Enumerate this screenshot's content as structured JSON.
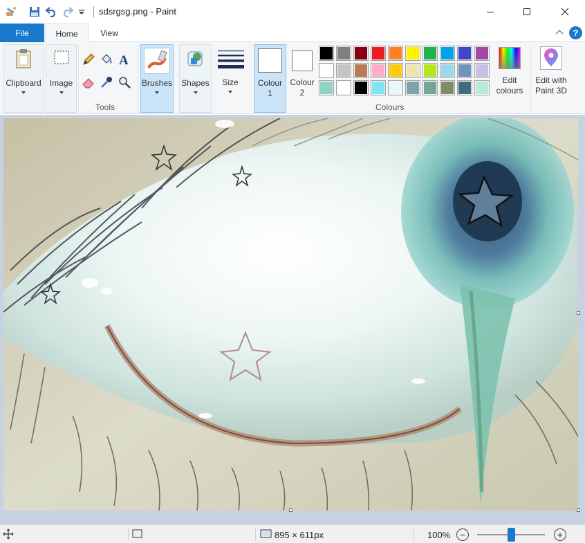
{
  "window": {
    "title": "sdsrgsg.png - Paint",
    "minimize_icon": "minimize-icon",
    "maximize_icon": "maximize-icon",
    "close_icon": "close-icon"
  },
  "quick_access": {
    "app_icon": "paint-app-icon",
    "save_icon": "save-icon",
    "undo_icon": "undo-icon",
    "redo_icon": "redo-icon",
    "customize_icon": "dropdown-arrow-icon"
  },
  "tabs": {
    "file": "File",
    "home": "Home",
    "view": "View",
    "help": "?"
  },
  "ribbon": {
    "clipboard": "Clipboard",
    "image": "Image",
    "tools_label": "Tools",
    "brushes": "Brushes",
    "shapes": "Shapes",
    "size": "Size",
    "colour1_line1": "Colour",
    "colour1_line2": "1",
    "colour2_line1": "Colour",
    "colour2_line2": "2",
    "colours_label": "Colours",
    "edit_colours_line1": "Edit",
    "edit_colours_line2": "colours",
    "paint3d_line1": "Edit with",
    "paint3d_line2": "Paint 3D",
    "colour1_value": "#ffffff",
    "colour2_value": "#ffffff",
    "palette": [
      [
        "#000000",
        "#7f7f7f",
        "#880015",
        "#ed1c24",
        "#ff7f27",
        "#fff200",
        "#22b14c",
        "#00a2e8",
        "#3f48cc",
        "#a349a4"
      ],
      [
        "#ffffff",
        "#c3c3c3",
        "#b97a57",
        "#ffaec9",
        "#ffc90e",
        "#efe4b0",
        "#b5e61d",
        "#99d9ea",
        "#7092be",
        "#c8bfe7"
      ],
      [
        "#8fd3c7",
        "#ffffff",
        "#000000",
        "#7ee6f2",
        "#e8f8f6",
        "#7ea1ab",
        "#76a596",
        "#7f8c6a",
        "#3e6e7c",
        "#b7ebd8"
      ]
    ]
  },
  "status": {
    "move_icon": "move-cursor-icon",
    "selection_icon": "selection-size-icon",
    "image_size_icon": "image-size-icon",
    "dimensions": "895 × 611px",
    "zoom_level": "100%",
    "zoom_out": "−",
    "zoom_in": "+",
    "zoom_slider_fraction": 0.5
  }
}
